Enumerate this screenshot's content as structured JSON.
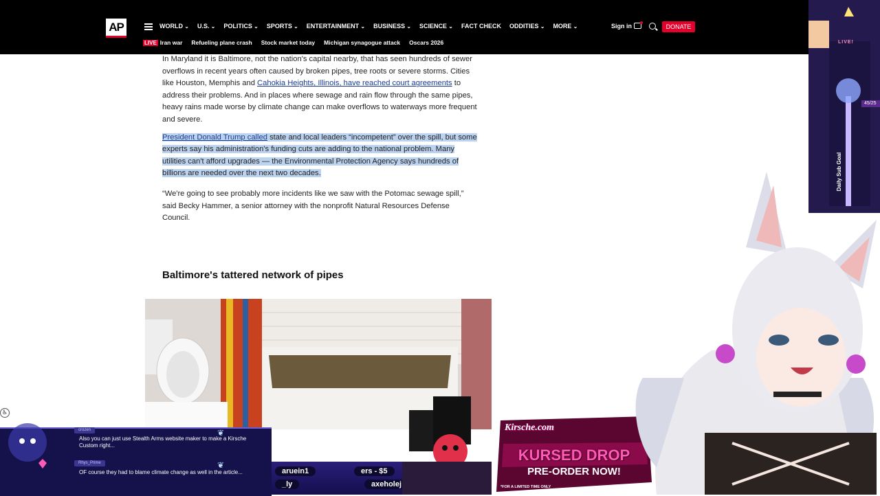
{
  "header": {
    "logo": "AP",
    "nav": [
      {
        "label": "WORLD",
        "caret": true
      },
      {
        "label": "U.S.",
        "caret": true
      },
      {
        "label": "POLITICS",
        "caret": true
      },
      {
        "label": "SPORTS",
        "caret": true
      },
      {
        "label": "ENTERTAINMENT",
        "caret": true
      },
      {
        "label": "BUSINESS",
        "caret": true
      },
      {
        "label": "SCIENCE",
        "caret": true
      },
      {
        "label": "FACT CHECK",
        "caret": false
      },
      {
        "label": "ODDITIES",
        "caret": true
      },
      {
        "label": "MORE",
        "caret": true
      }
    ],
    "signin": "Sign in",
    "donate": "DONATE",
    "live_badge": "LIVE",
    "trending": [
      "Iran war",
      "Refueling plane crash",
      "Stock market today",
      "Michigan synagogue attack",
      "Oscars 2026"
    ]
  },
  "article": {
    "p1_before": "In Maryland it is Baltimore, not the nation's capital nearby, that has seen hundreds of sewer overflows in recent years often caused by broken pipes, tree roots or severe storms. Cities like Houston, Memphis and ",
    "p1_link": "Cahokia Heights, Illinois, have reached court agreements",
    "p1_after": " to address their problems. And in places where sewage and rain flow through the same pipes, heavy rains made worse by climate change can make overflows to waterways more frequent and severe.",
    "p2_link": "President Donald Trump called",
    "p2_after": " state and local leaders “incompetent” over the spill, but some experts say his administration's funding cuts are adding to the national problem. Many utilities can't afford upgrades — the Environmental Protection Agency says hundreds of billions are needed over the next two decades.",
    "p3": "“We're going to see probably more incidents like we saw with the Potomac sewage spill,” said Becky Hammer, a senior attorney with the nonprofit Natural Resources Defense Council.",
    "subhead": "Baltimore's tattered network of pipes"
  },
  "overlay": {
    "chat": [
      {
        "user": "crozen",
        "text": "Also you can just use Stealth Arms website maker to make a Kirsche Custom right..."
      },
      {
        "user": "Rhys_Prime",
        "text": "OF course they had to blame climate change as well in the article..."
      }
    ],
    "ticker": [
      "aruein1",
      "ers - $5",
      "_ly",
      "axeholej"
    ],
    "promo": {
      "logo": "Kirsche.com",
      "title": "KURSED DROP",
      "subtitle": "PRE-ORDER NOW!",
      "fine": "*FOR A LIMITED TIME ONLY"
    },
    "goal": {
      "label": "Daily Sub Goal",
      "count": "45/25",
      "live": "LIVE!"
    }
  },
  "colors": {
    "ap_red": "#e4002b",
    "link": "#1a3b8f",
    "highlight": "#bcd3ef",
    "overlay_purple": "#15114a",
    "promo_pink": "#ff5ab6"
  }
}
